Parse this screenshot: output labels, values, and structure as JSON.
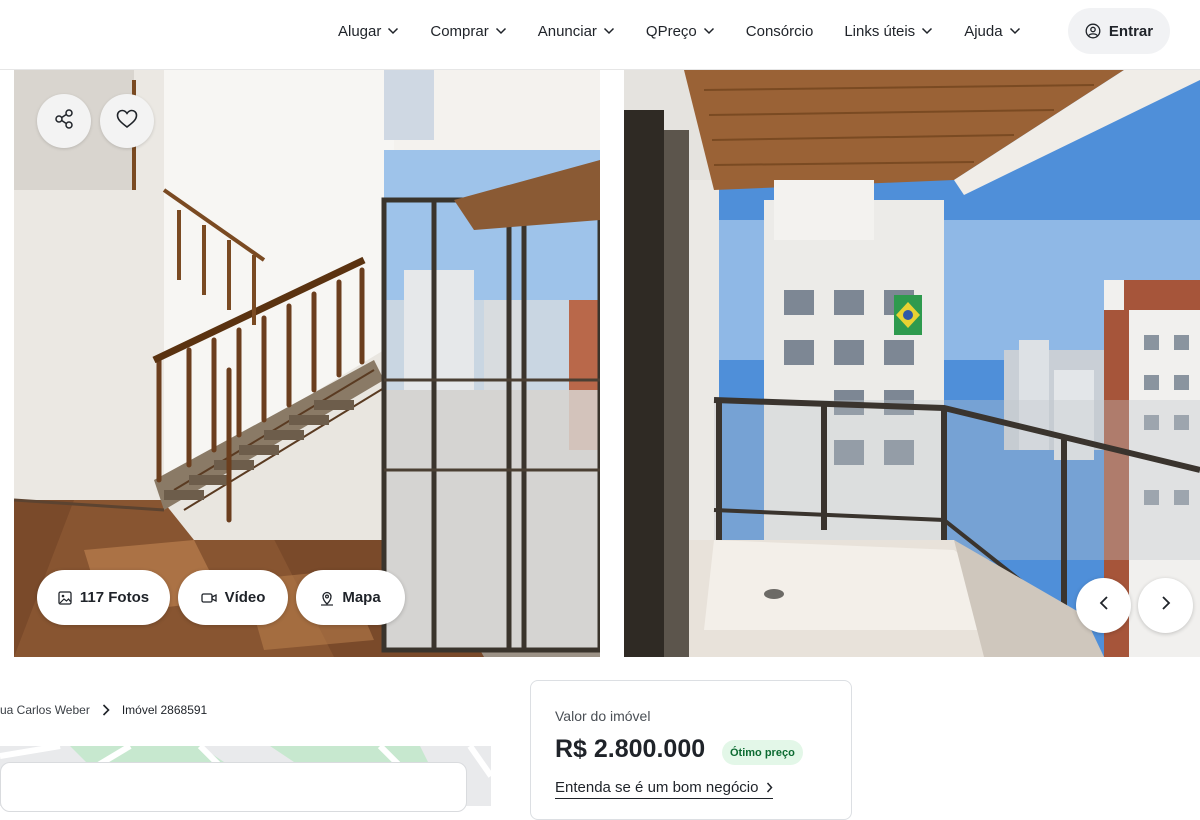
{
  "header": {
    "nav": [
      {
        "label": "Alugar",
        "has_dropdown": true
      },
      {
        "label": "Comprar",
        "has_dropdown": true
      },
      {
        "label": "Anunciar",
        "has_dropdown": true
      },
      {
        "label": "QPreço",
        "has_dropdown": true
      },
      {
        "label": "Consórcio",
        "has_dropdown": false
      },
      {
        "label": "Links úteis",
        "has_dropdown": true
      },
      {
        "label": "Ajuda",
        "has_dropdown": true
      }
    ],
    "login": {
      "label": "Entrar",
      "icon": "user-circle-icon"
    }
  },
  "gallery": {
    "share_icon": "share-icon",
    "favorite_icon": "heart-icon",
    "photos_button": {
      "label": "117 Fotos",
      "icon": "image-icon"
    },
    "video_button": {
      "label": "Vídeo",
      "icon": "video-camera-icon"
    },
    "map_button": {
      "label": "Mapa",
      "icon": "map-pin-icon"
    },
    "prev_icon": "chevron-left-icon",
    "next_icon": "chevron-right-icon"
  },
  "breadcrumb": {
    "items": [
      "ua Carlos Weber",
      "Imóvel 2868591"
    ]
  },
  "price_card": {
    "label": "Valor do imóvel",
    "value": "R$ 2.800.000",
    "badge": "Ótimo preço",
    "link": "Entenda se é um bom negócio"
  },
  "colors": {
    "text": "#1f2329",
    "badge_bg": "#e3f7e8",
    "badge_text": "#0d6b32",
    "login_bg": "#f1f2f4"
  }
}
